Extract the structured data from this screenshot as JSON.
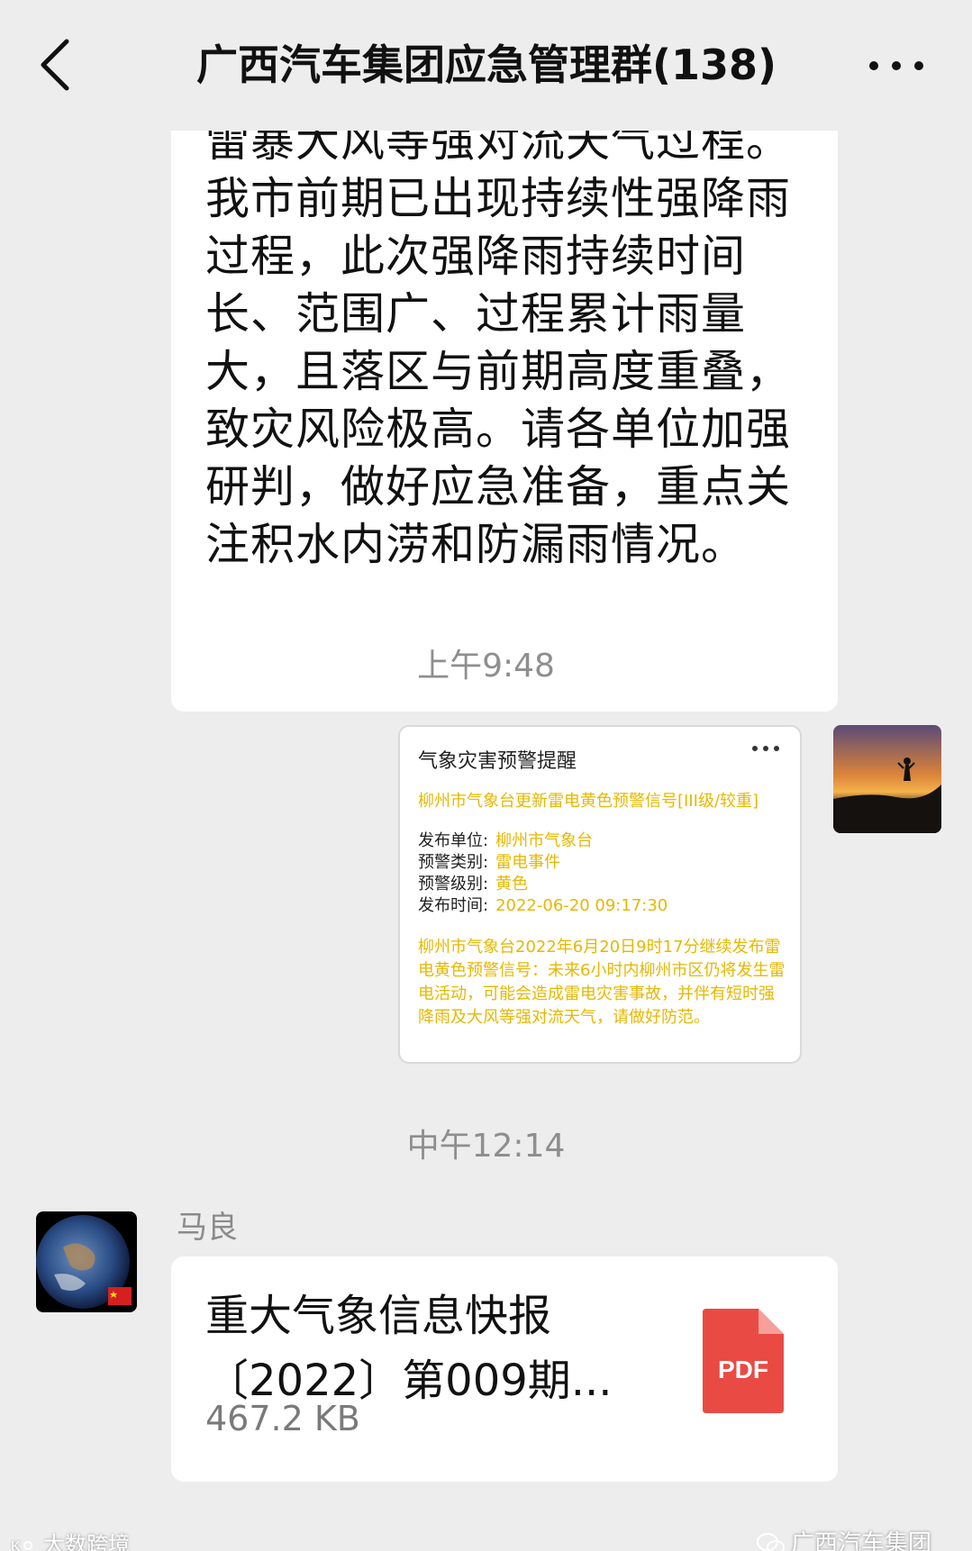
{
  "header": {
    "title": "广西汽车集团应急管理群(138)",
    "back_icon": "chevron-left-icon",
    "more_icon": "more-icon"
  },
  "messages": {
    "msg1_text": "雷暴大风等强对流天气过程。\n我市前期已出现持续性强降雨过程，此次强降雨持续时间长、范围广、过程累计雨量大，且落区与前期高度重叠，致灾风险极高。请各单位加强研判，做好应急准备，重点关注积水内涝和防漏雨情况。",
    "time1": "上午9:48",
    "time2": "中午12:14",
    "card": {
      "title": "气象灾害预警提醒",
      "subtitle": "柳州市气象台更新雷电黄色预警信号[III级/较重]",
      "fields": [
        {
          "label": "发布单位:",
          "value": "柳州市气象台"
        },
        {
          "label": "预警类别:",
          "value": "雷电事件"
        },
        {
          "label": "预警级别:",
          "value": "黄色"
        },
        {
          "label": "发布时间:",
          "value": "2022-06-20 09:17:30"
        }
      ],
      "body": "柳州市气象台2022年6月20日9时17分继续发布雷电黄色预警信号：未来6小时内柳州市区仍将发生雷电活动，可能会造成雷电灾害事故，并伴有短时强降雨及大风等强对流天气，请做好防范。"
    },
    "sender_name": "马良",
    "file": {
      "name": "重大气象信息快报〔2022〕第009期...",
      "size": "467.2 KB",
      "type_label": "PDF"
    }
  },
  "watermarks": {
    "left": "大数跨境",
    "right": "广西汽车集团"
  },
  "colors": {
    "background": "#ededed",
    "bubble": "#ffffff",
    "warning_yellow": "#e6b800",
    "pdf_red": "#e94b44"
  }
}
